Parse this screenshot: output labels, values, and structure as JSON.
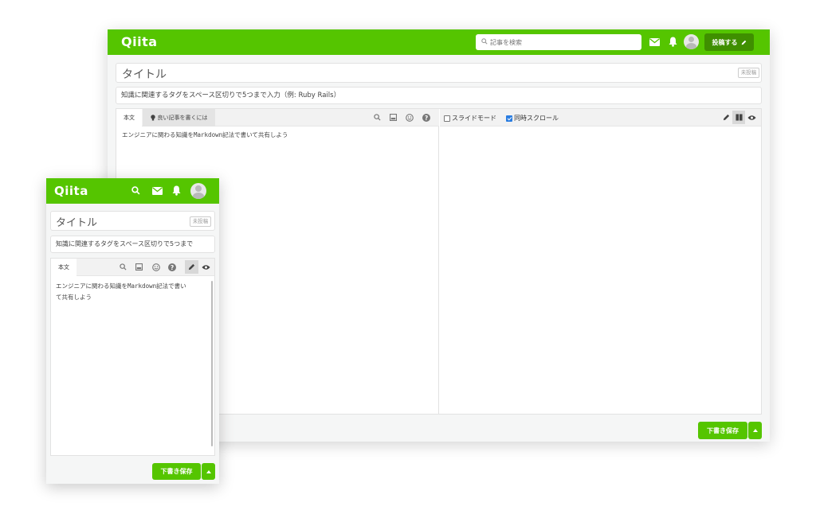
{
  "brand": {
    "logo": "Qiita",
    "accent": "#55c500",
    "accent_dark": "#3f8f00"
  },
  "desktop": {
    "search_placeholder": "記事を検索",
    "post_button": "投稿する",
    "title_placeholder": "タイトル",
    "status_badge": "未投稿",
    "tags_placeholder": "知識に関連するタグをスペース区切りで5つまで入力（例: Ruby Rails）",
    "tab_body": "本文",
    "tab_tip": "良い記事を書くには",
    "body_placeholder": "エンジニアに関わる知識をMarkdown記法で書いて共有しよう",
    "slide_mode": "スライドモード",
    "sync_scroll": "同時スクロール",
    "save_button": "下書き保存"
  },
  "mobile": {
    "title_placeholder": "タイトル",
    "status_badge": "未投稿",
    "tags_placeholder": "知識に関連するタグをスペース区切りで5つまで",
    "tab_body": "本文",
    "body_placeholder_line1": "エンジニアに関わる知識をMarkdown記法で書い",
    "body_placeholder_line2": "て共有しよう",
    "save_button": "下書き保存"
  },
  "icons": [
    "search-icon",
    "mail-icon",
    "bell-icon",
    "avatar-icon",
    "pencil-icon",
    "image-icon",
    "emoji-icon",
    "help-icon",
    "split-view-icon",
    "eye-icon",
    "lightbulb-icon",
    "caret-up-icon"
  ]
}
